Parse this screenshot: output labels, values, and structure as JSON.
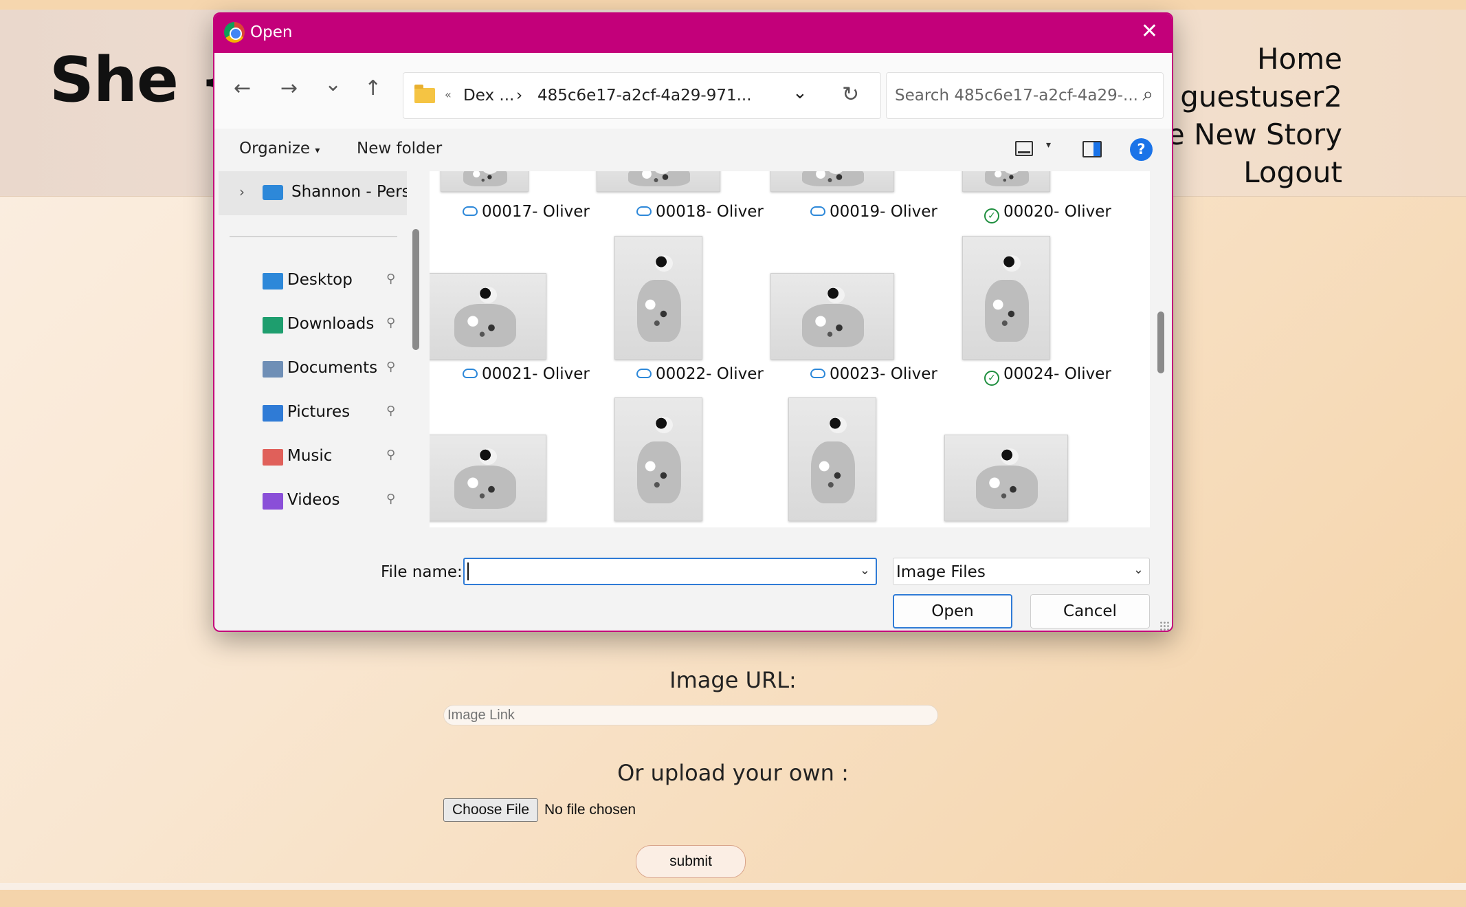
{
  "site": {
    "brand": "She {C",
    "nav": [
      "Home",
      "guestuser2",
      "ite New Story",
      "Logout"
    ]
  },
  "form": {
    "image_url_label": "Image URL:",
    "image_url_placeholder": "Image Link",
    "upload_label": "Or upload your own :",
    "choose_file": "Choose File",
    "no_file": "No file chosen",
    "submit": "submit"
  },
  "dialog": {
    "title": "Open",
    "close": "✕",
    "nav": {
      "back": "←",
      "forward": "→",
      "recent": "⌄",
      "up": "↑",
      "refresh": "↻",
      "address_dropdown": "⌄"
    },
    "address": {
      "overflow": "«",
      "crumb1": "Dex ...",
      "sep": "›",
      "crumb2": "485c6e17-a2cf-4a29-971..."
    },
    "search_placeholder": "Search 485c6e17-a2cf-4a29-...",
    "search_icon": "⌕",
    "toolbar": {
      "organize": "Organize",
      "organize_caret": "▾",
      "new_folder": "New folder",
      "view_caret": "▾",
      "help": "?"
    },
    "sidebar": {
      "onedrive": "Shannon - Perso",
      "chevron": "›",
      "pin": "📌",
      "quick_access": [
        {
          "label": "Desktop",
          "color": "#2d88d9"
        },
        {
          "label": "Downloads",
          "color": "#1e9e6e"
        },
        {
          "label": "Documents",
          "color": "#6f8fb6"
        },
        {
          "label": "Pictures",
          "color": "#2f7bd6"
        },
        {
          "label": "Music",
          "color": "#e0605a"
        },
        {
          "label": "Videos",
          "color": "#8a4fd8"
        }
      ]
    },
    "files": [
      {
        "name": "00017- Oliver",
        "status": "cloud"
      },
      {
        "name": "00018- Oliver",
        "status": "cloud"
      },
      {
        "name": "00019- Oliver",
        "status": "cloud"
      },
      {
        "name": "00020- Oliver",
        "status": "synced"
      },
      {
        "name": "00021- Oliver",
        "status": "cloud"
      },
      {
        "name": "00022- Oliver",
        "status": "cloud"
      },
      {
        "name": "00023- Oliver",
        "status": "cloud"
      },
      {
        "name": "00024- Oliver",
        "status": "synced"
      }
    ],
    "file_name_label": "File name:",
    "file_name_value": "",
    "file_type": "Image Files",
    "open_label": "Open",
    "cancel_label": "Cancel",
    "dropdown_caret": "⌄",
    "check": "✓"
  }
}
